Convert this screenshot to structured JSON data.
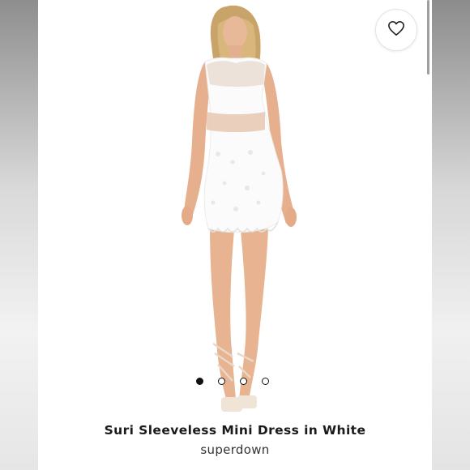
{
  "product": {
    "title": "Suri Sleeveless Mini Dress in White",
    "brand": "superdown"
  },
  "gallery": {
    "image_count": 4,
    "active_index": 0
  },
  "icons": {
    "wishlist": "heart-outline-icon"
  },
  "colors": {
    "background": "#ffffff",
    "text": "#1a1a1a",
    "dot_active": "#111111"
  }
}
